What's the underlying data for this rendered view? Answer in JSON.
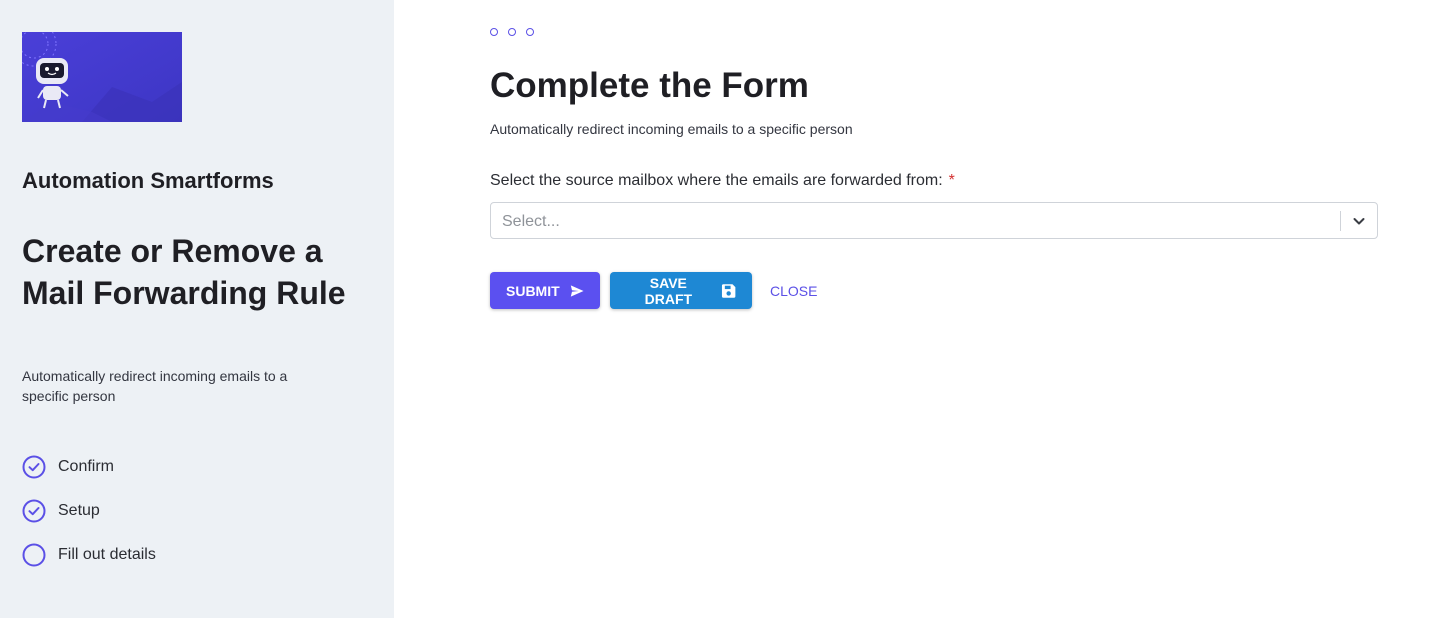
{
  "sidebar": {
    "logo_icon": "robot-mascot",
    "app_name": "Automation Smartforms",
    "title": "Create or Remove a Mail Forwarding Rule",
    "description": "Automatically redirect incoming emails to a specific person",
    "steps": [
      {
        "label": "Confirm",
        "status": "done",
        "icon": "check-circle-icon"
      },
      {
        "label": "Setup",
        "status": "done",
        "icon": "check-circle-icon"
      },
      {
        "label": "Fill out details",
        "status": "current",
        "icon": "empty-circle-icon"
      }
    ]
  },
  "main": {
    "progress_dots": 3,
    "title": "Complete the Form",
    "subtitle": "Automatically redirect incoming emails to a specific person",
    "field": {
      "label": "Select the source mailbox where the emails are forwarded from:",
      "required_marker": "*",
      "placeholder": "Select..."
    },
    "actions": {
      "submit_label": "SUBMIT",
      "save_draft_label": "SAVE DRAFT",
      "close_label": "CLOSE"
    }
  },
  "colors": {
    "accent": "#5b50f0",
    "draft": "#1e88d4",
    "sidebar_bg": "#edf1f5",
    "required": "#d32f2f"
  }
}
